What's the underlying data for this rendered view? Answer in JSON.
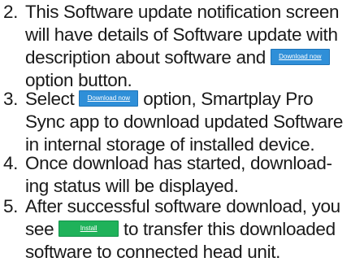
{
  "colors": {
    "text": "#1a1a1a",
    "download_button": "#2f8fd8",
    "install_button": "#1fb25a"
  },
  "steps": [
    {
      "number": "2.",
      "lines": [
        "This Software update notification screen",
        "will have details of Software update with",
        "description about software and",
        "option button."
      ],
      "button_label": "Download now"
    },
    {
      "number": "3.",
      "lines": [
        "Select",
        "option, Smartplay Pro",
        "Sync app to download updated Software",
        "in internal storage of installed device."
      ],
      "button_label": "Download now"
    },
    {
      "number": "4.",
      "lines": [
        "Once download has started, download-",
        "ing status will be displayed."
      ]
    },
    {
      "number": "5.",
      "lines": [
        "After successful software download, you",
        "see",
        "to transfer this downloaded",
        "software to connected head unit."
      ],
      "button_label": "Install"
    }
  ]
}
